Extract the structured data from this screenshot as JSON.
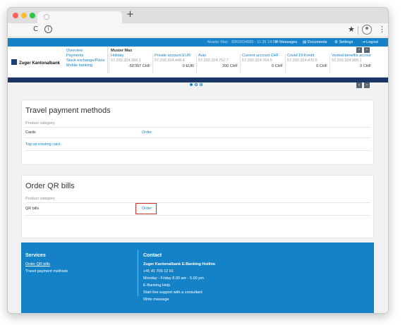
{
  "browser": {
    "new_tab": "+",
    "reload": "C",
    "info": "i",
    "star": "★",
    "menu": "⋮"
  },
  "topbar": {
    "user": "Muster Max",
    "contract": "93K0034689 - 11:35 14:59",
    "messages": "✉ Messages",
    "documents": "▤ Documents",
    "settings": "⚙ Settings",
    "logout": "⇥ Logout"
  },
  "header": {
    "bank_name": "Zuger Kantonalbank",
    "subnav": [
      "Overview",
      "Payments",
      "Stock exchange/Plans",
      "Mobile banking"
    ],
    "owner": "Muster Max",
    "accounts": [
      {
        "name": "Holiday",
        "iban": "57.202.324.366.1",
        "balance": "-50'397 CHF"
      },
      {
        "name": "Private account EUR",
        "iban": "57.202.324.448.6",
        "balance": "0 EUR"
      },
      {
        "name": "Auto",
        "iban": "57.202.324.752.7",
        "balance": "200 CHF"
      },
      {
        "name": "Current account CHF",
        "iban": "57.202.324.764.5",
        "balance": "0 CHF"
      },
      {
        "name": "Covid-19-Kredit",
        "iban": "57.202.324.470.6",
        "balance": "0 CHF"
      },
      {
        "name": "Vested benefits accour",
        "iban": "57.202.324.989.1",
        "balance": "0 CHF"
      }
    ],
    "prev": "‹",
    "next": "›"
  },
  "carousel": {
    "prev": "‹",
    "next": "›"
  },
  "travel": {
    "title": "Travel payment methods",
    "col_label": "Product category",
    "rows": [
      {
        "name": "Cards",
        "action": "Order"
      }
    ],
    "topup": "Top up existing card"
  },
  "qr": {
    "title": "Order QR bills",
    "col_label": "Product category",
    "rows": [
      {
        "name": "QR bills",
        "action": "Order"
      }
    ]
  },
  "footer": {
    "services_title": "Services",
    "services": [
      "Order QR bills",
      "Travel payment methods"
    ],
    "contact_title": "Contact",
    "contact": [
      "Zuger Kantonalbank E-Banking Hotline",
      "+41 41 709 12 61",
      "Monday - Friday 8.00 am - 5.00 pm",
      "E-Banking Help",
      "Start live support with a consultant",
      "Write message"
    ]
  },
  "colors": {
    "primary": "#1582c8",
    "navy": "#1b3566",
    "highlight": "#d0302f"
  }
}
